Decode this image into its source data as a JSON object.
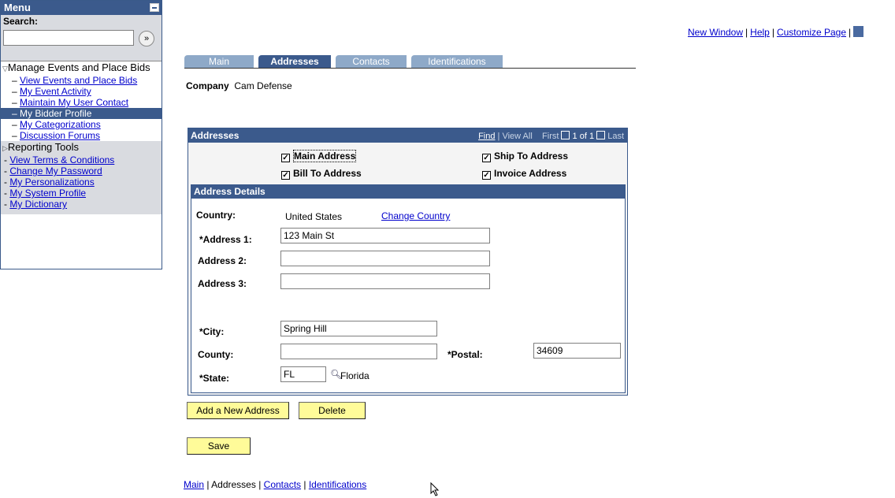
{
  "menu": {
    "title": "Menu",
    "search_label": "Search:",
    "search_value": "",
    "search_go": "»",
    "items": [
      {
        "label": "Manage Events and Place Bids"
      },
      {
        "label": "View Events and Place Bids"
      },
      {
        "label": "My Event Activity"
      },
      {
        "label": "Maintain My User Contact"
      },
      {
        "label": "My Bidder Profile"
      },
      {
        "label": "My Categorizations"
      },
      {
        "label": "Discussion Forums"
      },
      {
        "label": "Reporting Tools"
      },
      {
        "label": "View Terms & Conditions"
      },
      {
        "label": "Change My Password"
      },
      {
        "label": "My Personalizations"
      },
      {
        "label": "My System Profile"
      },
      {
        "label": "My Dictionary"
      }
    ]
  },
  "toplinks": {
    "new_window": "New Window",
    "help": "Help",
    "customize": "Customize Page",
    "sep": "|"
  },
  "tabs": [
    {
      "label": "Main"
    },
    {
      "label": "Addresses"
    },
    {
      "label": "Contacts"
    },
    {
      "label": "Identifications"
    }
  ],
  "company": {
    "label": "Company",
    "value": "Cam Defense"
  },
  "addresses": {
    "title": "Addresses",
    "nav": {
      "find": "Find",
      "sep": "|",
      "view_all": "View All",
      "first": "First",
      "count": "1 of 1",
      "last": "Last"
    },
    "checks": {
      "main": "Main Address",
      "ship": "Ship To Address",
      "bill": "Bill To Address",
      "invoice": "Invoice Address",
      "mark": "✓"
    },
    "details": {
      "title": "Address Details",
      "country_label": "Country:",
      "country_value": "United States",
      "change_country": "Change Country",
      "address1_label": "*Address 1:",
      "address1_value": "123 Main St",
      "address2_label": "Address 2:",
      "address2_value": "",
      "address3_label": "Address 3:",
      "address3_value": "",
      "city_label": "*City:",
      "city_value": "Spring Hill",
      "county_label": "County:",
      "county_value": "",
      "postal_label": "*Postal:",
      "postal_value": "34609",
      "state_label": "*State:",
      "state_value": "FL",
      "state_name": "Florida"
    }
  },
  "buttons": {
    "add": "Add a New Address",
    "delete": "Delete",
    "save": "Save"
  },
  "bottomlinks": {
    "main": "Main",
    "addresses": "Addresses",
    "contacts": "Contacts",
    "identifications": "Identifications",
    "sep": "|"
  }
}
